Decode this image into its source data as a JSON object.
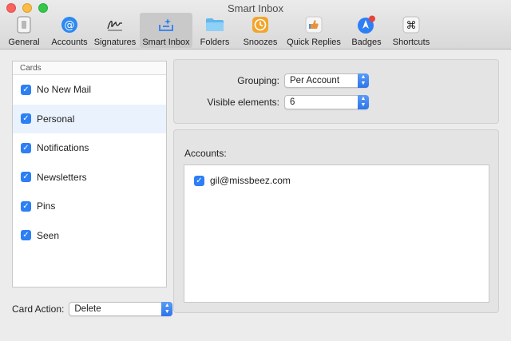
{
  "window": {
    "title": "Smart Inbox"
  },
  "toolbar": {
    "items": [
      {
        "label": "General",
        "icon": "general-icon"
      },
      {
        "label": "Accounts",
        "icon": "at-sign-icon"
      },
      {
        "label": "Signatures",
        "icon": "signature-icon"
      },
      {
        "label": "Smart Inbox",
        "icon": "smart-inbox-icon",
        "active": true
      },
      {
        "label": "Folders",
        "icon": "folder-icon"
      },
      {
        "label": "Snoozes",
        "icon": "clock-icon"
      },
      {
        "label": "Quick Replies",
        "icon": "quick-replies-icon"
      },
      {
        "label": "Badges",
        "icon": "badge-icon"
      },
      {
        "label": "Shortcuts",
        "icon": "command-key-icon"
      }
    ],
    "command_glyph": "⌘"
  },
  "cards": {
    "header": "Cards",
    "items": [
      {
        "label": "No New Mail",
        "checked": true
      },
      {
        "label": "Personal",
        "checked": true,
        "selected": true
      },
      {
        "label": "Notifications",
        "checked": true
      },
      {
        "label": "Newsletters",
        "checked": true
      },
      {
        "label": "Pins",
        "checked": true
      },
      {
        "label": "Seen",
        "checked": true
      }
    ],
    "checkmark": "✓"
  },
  "card_action": {
    "label": "Card Action:",
    "value": "Delete"
  },
  "grouping": {
    "label": "Grouping:",
    "value": "Per Account"
  },
  "visible_elements": {
    "label": "Visible elements:",
    "value": "6"
  },
  "accounts": {
    "label": "Accounts:",
    "items": [
      {
        "email": "gil@missbeez.com",
        "checked": true
      }
    ]
  },
  "colors": {
    "accent": "#2d7ff5",
    "selection": "#eaf2fd",
    "badge_red": "#e8433a",
    "snooze_orange": "#f2a52a"
  }
}
